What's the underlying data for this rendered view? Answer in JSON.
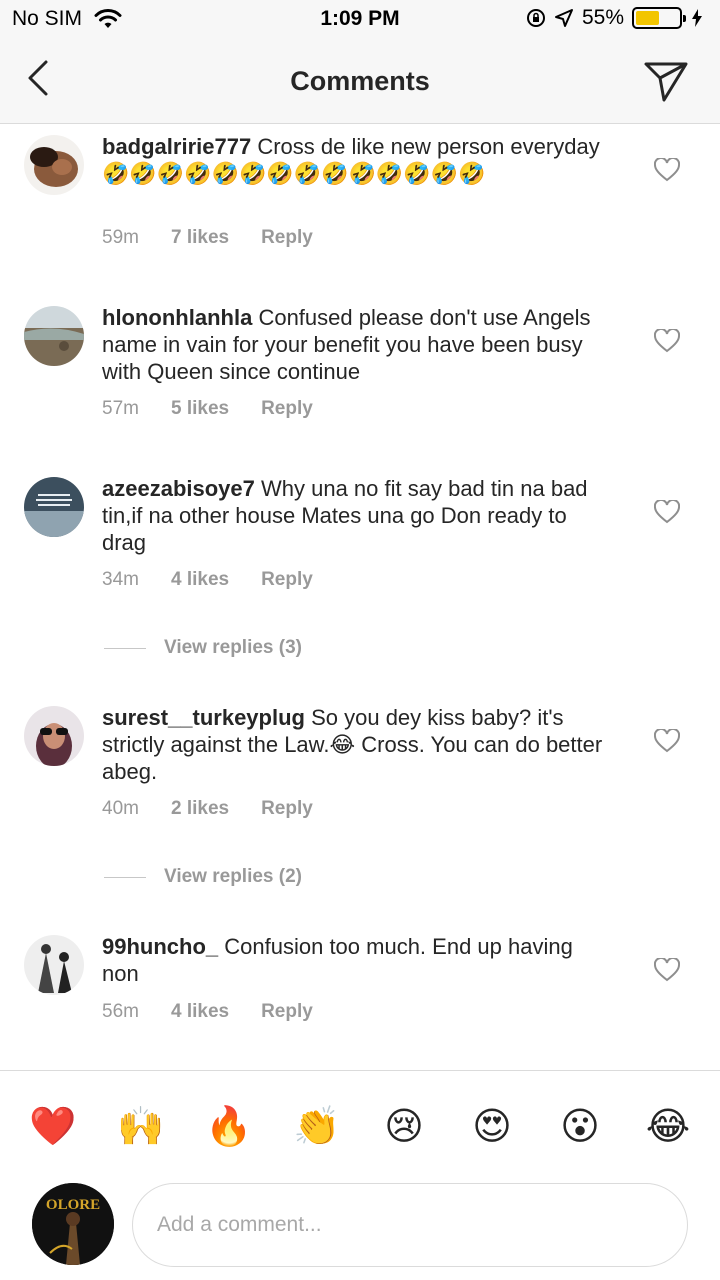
{
  "status_bar": {
    "carrier": "No SIM",
    "time": "1:09 PM",
    "battery": "55%",
    "battery_level": 0.55,
    "battery_color": "#f2c500"
  },
  "header": {
    "title": "Comments",
    "back_icon": "chevron-left-icon",
    "send_icon": "paper-plane-icon"
  },
  "comments": [
    {
      "username": "badgalririe777",
      "text": "Cross de like new person everyday 🤣🤣🤣🤣🤣🤣🤣🤣🤣🤣🤣🤣🤣🤣",
      "time": "59m",
      "likes": "7 likes",
      "reply": "Reply"
    },
    {
      "username": "hlononhlanhla",
      "text": "Confused  please  don't  use Angels  name in vain for your  benefit you have  been  busy with  Queen  since  continue",
      "time": "57m",
      "likes": "5 likes",
      "reply": "Reply"
    },
    {
      "username": "azeezabisoye7",
      "text": "Why una no fit say bad tin na bad tin,if na other house Mates una go Don ready to drag",
      "time": "34m",
      "likes": "4 likes",
      "reply": "Reply",
      "view_replies": "View replies (3)"
    },
    {
      "username": "surest__turkeyplug",
      "text": "So you dey kiss baby? it's strictly against the Law.😂 Cross. You can do better abeg.",
      "time": "40m",
      "likes": "2 likes",
      "reply": "Reply",
      "view_replies": "View replies (2)"
    },
    {
      "username": "99huncho_",
      "text": "Confusion too much. End up having non",
      "time": "56m",
      "likes": "4 likes",
      "reply": "Reply"
    }
  ],
  "emoji_bar": [
    "❤️",
    "🙌",
    "🔥",
    "👏",
    "😢",
    "😍",
    "😮",
    "😂"
  ],
  "composer": {
    "placeholder": "Add a comment...",
    "avatar_text": "OLORE"
  }
}
